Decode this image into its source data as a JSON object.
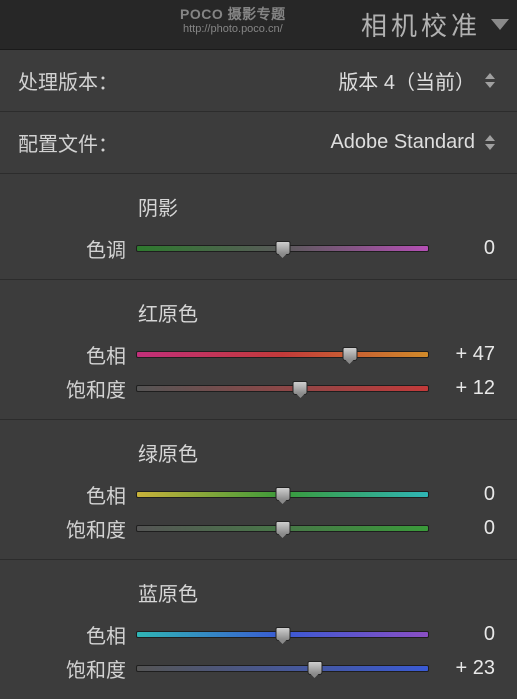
{
  "watermark": {
    "brand": "POCO 摄影专题",
    "url": "http://photo.poco.cn/"
  },
  "panel": {
    "title": "相机校准"
  },
  "version_row": {
    "label": "处理版本：",
    "value": "版本 4（当前）"
  },
  "profile_row": {
    "label": "配置文件：",
    "value": "Adobe Standard"
  },
  "groups": {
    "shadow": {
      "header": "阴影",
      "tint": {
        "label": "色调",
        "value": "0",
        "pct": 50,
        "gradient": "linear-gradient(to right,#2e7a2e,#5a5a5a 50%,#b44fb4)"
      }
    },
    "red": {
      "header": "红原色",
      "hue": {
        "label": "色相",
        "value": "+ 47",
        "pct": 73,
        "gradient": "linear-gradient(to right,#c12f7a,#c23a3a 50%,#d08a2a)"
      },
      "sat": {
        "label": "饱和度",
        "value": "+ 12",
        "pct": 56,
        "gradient": "linear-gradient(to right,#555,#c23a3a)"
      }
    },
    "green": {
      "header": "绿原色",
      "hue": {
        "label": "色相",
        "value": "0",
        "pct": 50,
        "gradient": "linear-gradient(to right,#c9b23a,#3a9a3a 50%,#2fb5b5)"
      },
      "sat": {
        "label": "饱和度",
        "value": "0",
        "pct": 50,
        "gradient": "linear-gradient(to right,#555,#3a9a3a)"
      }
    },
    "blue": {
      "header": "蓝原色",
      "hue": {
        "label": "色相",
        "value": "0",
        "pct": 50,
        "gradient": "linear-gradient(to right,#2fb5b5,#3a5ad4 50%,#8a4fc4)"
      },
      "sat": {
        "label": "饱和度",
        "value": "+ 23",
        "pct": 61,
        "gradient": "linear-gradient(to right,#555,#3a5ad4)"
      }
    }
  }
}
